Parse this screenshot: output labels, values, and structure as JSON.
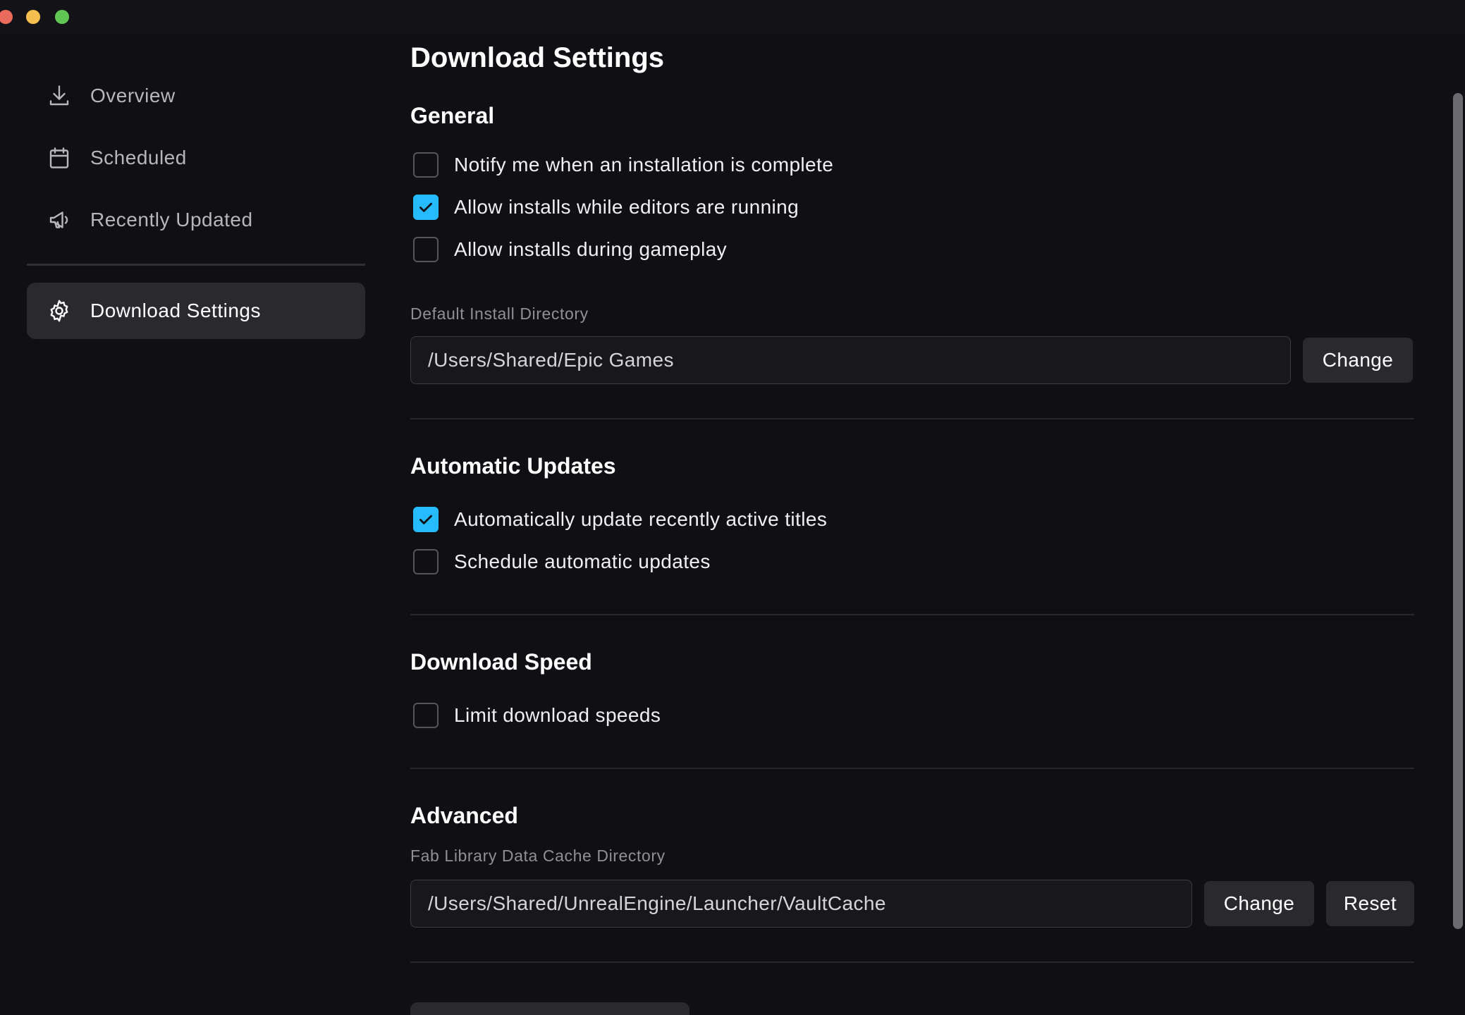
{
  "sidebar": {
    "items": [
      {
        "label": "Overview",
        "icon": "download-icon"
      },
      {
        "label": "Scheduled",
        "icon": "calendar-icon"
      },
      {
        "label": "Recently Updated",
        "icon": "megaphone-icon"
      }
    ],
    "active_item": {
      "label": "Download Settings",
      "icon": "gear-icon"
    }
  },
  "page": {
    "title": "Download Settings"
  },
  "general": {
    "title": "General",
    "options": [
      {
        "label": "Notify me when an installation is complete",
        "checked": false
      },
      {
        "label": "Allow installs while editors are running",
        "checked": true
      },
      {
        "label": "Allow installs during gameplay",
        "checked": false
      }
    ],
    "install_dir": {
      "label": "Default Install Directory",
      "value": "/Users/Shared/Epic Games",
      "change_label": "Change"
    }
  },
  "auto_updates": {
    "title": "Automatic Updates",
    "options": [
      {
        "label": "Automatically update recently active titles",
        "checked": true
      },
      {
        "label": "Schedule automatic updates",
        "checked": false
      }
    ]
  },
  "download_speed": {
    "title": "Download Speed",
    "options": [
      {
        "label": "Limit download speeds",
        "checked": false
      }
    ]
  },
  "advanced": {
    "title": "Advanced",
    "cache_dir": {
      "label": "Fab Library Data Cache Directory",
      "value": "/Users/Shared/UnrealEngine/Launcher/VaultCache",
      "change_label": "Change",
      "reset_label": "Reset"
    }
  },
  "colors": {
    "background": "#101014",
    "accent": "#26bbff",
    "button": "#2a2a2e"
  }
}
